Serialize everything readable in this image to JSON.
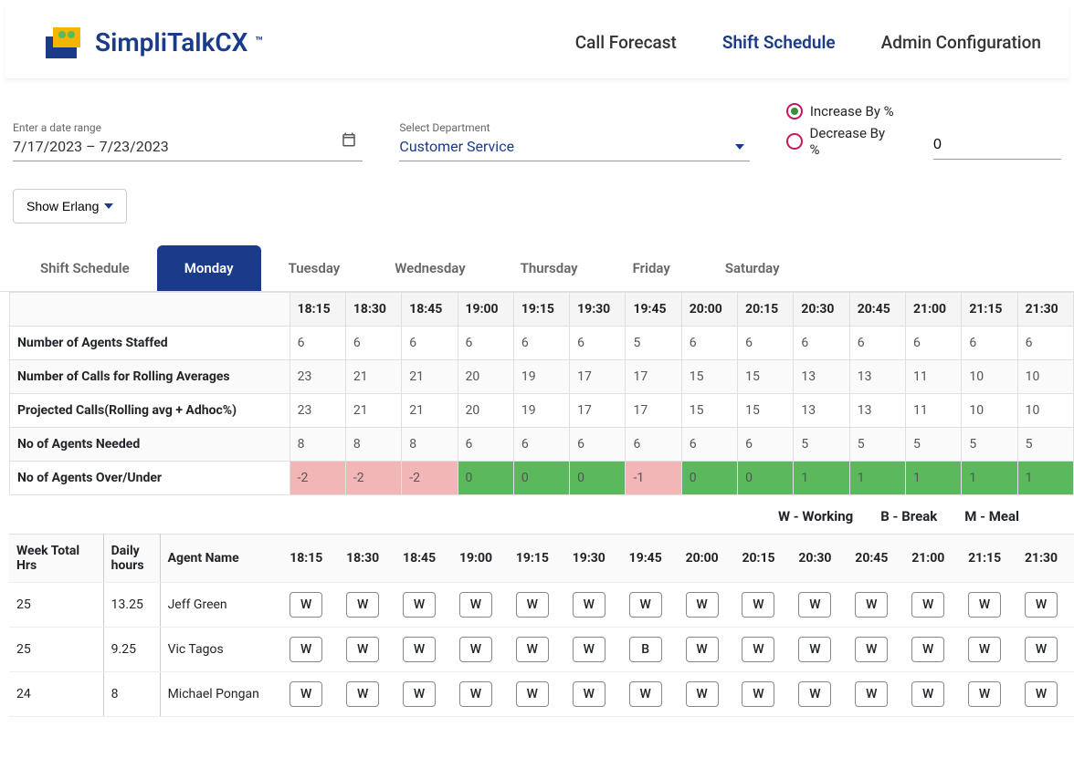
{
  "brand": "SimpliTalkCX",
  "trademark": "™",
  "nav": {
    "forecast": "Call Forecast",
    "schedule": "Shift Schedule",
    "admin": "Admin Configuration"
  },
  "filters": {
    "date_label": "Enter a date range",
    "date_value": "7/17/2023 – 7/23/2023",
    "dept_label": "Select Department",
    "dept_value": "Customer Service",
    "increase_label": "Increase By %",
    "decrease_label": "Decrease By %",
    "pct_value": "0"
  },
  "erlang_button": "Show Erlang",
  "tabs": [
    "Shift Schedule",
    "Monday",
    "Tuesday",
    "Wednesday",
    "Thursday",
    "Friday",
    "Saturday"
  ],
  "active_tab": "Monday",
  "time_slots": [
    "18:15",
    "18:30",
    "18:45",
    "19:00",
    "19:15",
    "19:30",
    "19:45",
    "20:00",
    "20:15",
    "20:30",
    "20:45",
    "21:00",
    "21:15",
    "21:30"
  ],
  "summary_rows": [
    {
      "label": "Number of Agents Staffed",
      "values": [
        "6",
        "6",
        "6",
        "6",
        "6",
        "6",
        "5",
        "6",
        "6",
        "6",
        "6",
        "6",
        "6",
        "6"
      ]
    },
    {
      "label": "Number of Calls for Rolling Averages",
      "values": [
        "23",
        "21",
        "21",
        "20",
        "19",
        "17",
        "17",
        "15",
        "15",
        "13",
        "13",
        "11",
        "10",
        "10"
      ]
    },
    {
      "label": "Projected Calls(Rolling avg + Adhoc%)",
      "values": [
        "23",
        "21",
        "21",
        "20",
        "19",
        "17",
        "17",
        "15",
        "15",
        "13",
        "13",
        "11",
        "10",
        "10"
      ]
    },
    {
      "label": "No of Agents Needed",
      "values": [
        "8",
        "8",
        "8",
        "6",
        "6",
        "6",
        "6",
        "6",
        "6",
        "5",
        "5",
        "5",
        "5",
        "5"
      ]
    },
    {
      "label": "No of Agents Over/Under",
      "values": [
        "-2",
        "-2",
        "-2",
        "0",
        "0",
        "0",
        "-1",
        "0",
        "0",
        "1",
        "1",
        "1",
        "1",
        "1"
      ],
      "color": true
    }
  ],
  "legend": {
    "w": "W - Working",
    "b": "B - Break",
    "m": "M - Meal"
  },
  "agent_headers": {
    "week": "Week Total Hrs",
    "daily": "Daily hours",
    "name": "Agent Name"
  },
  "agents": [
    {
      "week": "25",
      "daily": "13.25",
      "name": "Jeff Green",
      "slots": [
        "W",
        "W",
        "W",
        "W",
        "W",
        "W",
        "W",
        "W",
        "W",
        "W",
        "W",
        "W",
        "W",
        "W"
      ]
    },
    {
      "week": "25",
      "daily": "9.25",
      "name": "Vic Tagos",
      "slots": [
        "W",
        "W",
        "W",
        "W",
        "W",
        "W",
        "B",
        "W",
        "W",
        "W",
        "W",
        "W",
        "W",
        "W"
      ]
    },
    {
      "week": "24",
      "daily": "8",
      "name": "Michael Pongan",
      "slots": [
        "W",
        "W",
        "W",
        "W",
        "W",
        "W",
        "W",
        "W",
        "W",
        "W",
        "W",
        "W",
        "W",
        "W"
      ]
    }
  ]
}
